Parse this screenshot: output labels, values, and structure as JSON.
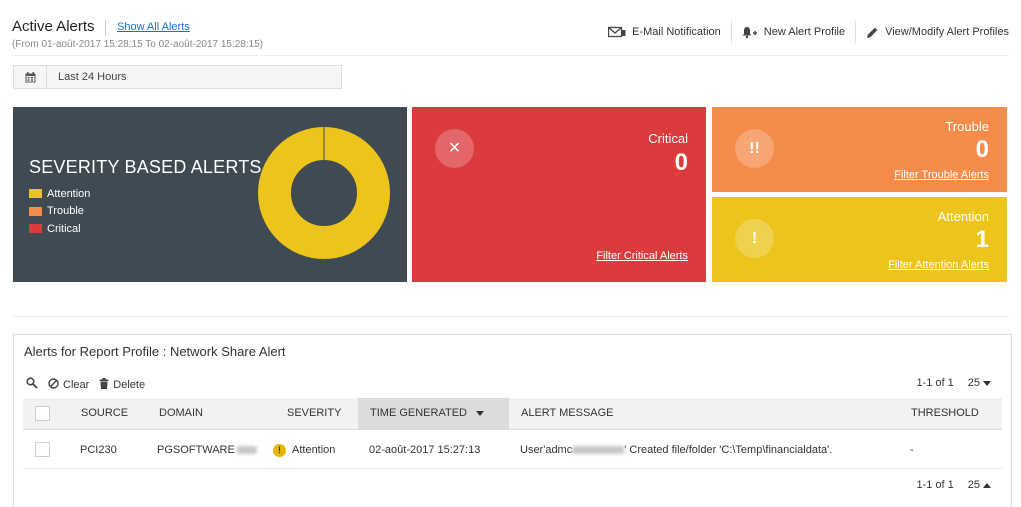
{
  "header": {
    "title": "Active Alerts",
    "show_all_link": "Show All Alerts",
    "range_text": "(From 01-août-2017 15:28:15 To 02-août-2017 15:28:15)"
  },
  "toolbar": {
    "email_label": "E-Mail Notification",
    "new_profile_label": "New Alert Profile",
    "modify_profiles_label": "View/Modify Alert Profiles"
  },
  "date_filter": {
    "value": "Last 24 Hours"
  },
  "severity_panel": {
    "title": "SEVERITY BASED ALERTS",
    "legend": [
      {
        "label": "Attention",
        "color": "#ecc41c"
      },
      {
        "label": "Trouble",
        "color": "#f58c4b"
      },
      {
        "label": "Critical",
        "color": "#dc3b3e"
      }
    ]
  },
  "chart_data": {
    "type": "pie",
    "title": "SEVERITY BASED ALERTS",
    "categories": [
      "Attention",
      "Trouble",
      "Critical"
    ],
    "values": [
      1,
      0,
      0
    ],
    "colors": [
      "#ecc41c",
      "#f58c4b",
      "#dc3b3e"
    ],
    "style": "donut",
    "legend": "left"
  },
  "cards": {
    "critical": {
      "label": "Critical",
      "count": "0",
      "link": "Filter Critical Alerts",
      "icon": "×",
      "color": "#dc3b3e"
    },
    "trouble": {
      "label": "Trouble",
      "count": "0",
      "link": "Filter Trouble Alerts",
      "icon": "!!",
      "color": "#f58c4b"
    },
    "attention": {
      "label": "Attention",
      "count": "1",
      "link": "Filter Attention Alerts",
      "icon": "!",
      "color": "#ecc41c"
    }
  },
  "grid": {
    "title": "Alerts for Report Profile : Network Share Alert",
    "clear_label": "Clear",
    "delete_label": "Delete",
    "pager_text": "1-1 of 1",
    "page_size": "25",
    "columns": [
      "SOURCE",
      "DOMAIN",
      "SEVERITY",
      "TIME GENERATED",
      "ALERT MESSAGE",
      "THRESHOLD"
    ],
    "rows": [
      {
        "source": "PCI230",
        "domain": "PGSOFTWARE",
        "severity": "Attention",
        "time": "02-août-2017 15:27:13",
        "message_prefix": "User'admc",
        "message_suffix": "' Created file/folder 'C:\\Temp\\financialdata'.",
        "threshold": "-"
      }
    ]
  }
}
